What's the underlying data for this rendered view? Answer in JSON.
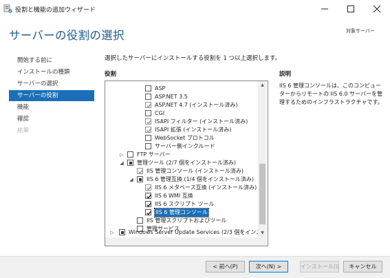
{
  "window": {
    "title": "役割と機能の追加ウィザード",
    "minimize_icon": "minimize-icon",
    "maximize_icon": "maximize-icon",
    "close_icon": "close-icon"
  },
  "header": {
    "title": "サーバーの役割の選択",
    "target_server_label": "対象サーバー"
  },
  "nav": {
    "items": [
      {
        "label": "開始する前に",
        "state": "normal"
      },
      {
        "label": "インストールの種類",
        "state": "normal"
      },
      {
        "label": "サーバーの選択",
        "state": "normal"
      },
      {
        "label": "サーバーの役割",
        "state": "active"
      },
      {
        "label": "機能",
        "state": "normal"
      },
      {
        "label": "確認",
        "state": "normal"
      },
      {
        "label": "結果",
        "state": "disabled"
      }
    ]
  },
  "main": {
    "instruction": "選択したサーバーにインストールする役割を 1 つ以上選択します。",
    "roles_heading": "役割",
    "description_heading": "説明",
    "description_text": "IIS 6 管理コンソールは、このコンピューターからリモートの IIS 6.0 サーバーを管理するためのインフラストラクチャです。"
  },
  "tree": {
    "rows": [
      {
        "label": "ASP",
        "check": "unchecked"
      },
      {
        "label": "ASP.NET 3.5",
        "check": "unchecked"
      },
      {
        "label": "ASP.NET 4.7 (インストール済み)",
        "check": "checked-disabled"
      },
      {
        "label": "CGI",
        "check": "unchecked"
      },
      {
        "label": "ISAPI フィルター (インストール済み)",
        "check": "checked-disabled"
      },
      {
        "label": "ISAPI 拡張 (インストール済み)",
        "check": "checked-disabled"
      },
      {
        "label": "WebSocket プロトコル",
        "check": "unchecked"
      },
      {
        "label": "サーバー側インクルード",
        "check": "unchecked"
      },
      {
        "label": "FTP サーバー",
        "check": "unchecked",
        "expander": "collapsed"
      },
      {
        "label": "管理ツール (2/7 個をインストール済み)",
        "check": "partial",
        "expander": "expanded"
      },
      {
        "label": "IIS 管理コンソール (インストール済み)",
        "check": "checked-disabled"
      },
      {
        "label": "IIS 6 管理互換 (1/4 個をインストール済み)",
        "check": "partial",
        "expander": "expanded"
      },
      {
        "label": "IIS 6 メタベース互換 (インストール済み)",
        "check": "checked-disabled"
      },
      {
        "label": "IIS 6 WMI 互換",
        "check": "checked"
      },
      {
        "label": "IIS 6 スクリプト ツール",
        "check": "checked"
      },
      {
        "label": "IIS 6 管理コンソール",
        "check": "checked",
        "selected": true
      },
      {
        "label": "IIS 管理スクリプトおよびツール",
        "check": "unchecked"
      },
      {
        "label": "管理サービス",
        "check": "unchecked"
      },
      {
        "label": "Windows Server Update Services (2/3 個をインスト",
        "check": "partial",
        "expander": "collapsed"
      }
    ]
  },
  "footer": {
    "prev_label": "< 前へ(P)",
    "next_label": "次へ(N) >",
    "install_label": "インストール(I)",
    "cancel_label": "キャンセル"
  }
}
